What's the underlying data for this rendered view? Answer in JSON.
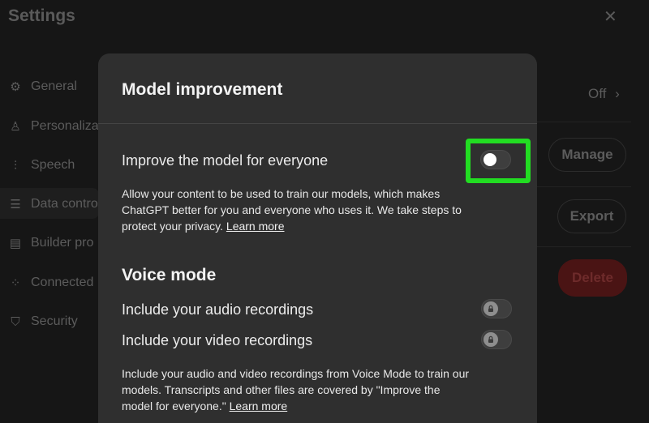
{
  "background": {
    "title": "Settings",
    "close_glyph": "✕",
    "nav": [
      {
        "icon": "gear-icon",
        "glyph": "⚙",
        "label": "General"
      },
      {
        "icon": "person-icon",
        "glyph": "♙",
        "label": "Personaliza"
      },
      {
        "icon": "waveform-icon",
        "glyph": "⫶",
        "label": "Speech"
      },
      {
        "icon": "database-icon",
        "glyph": "☰",
        "label": "Data contro"
      },
      {
        "icon": "builder-icon",
        "glyph": "▤",
        "label": "Builder pro"
      },
      {
        "icon": "apps-icon",
        "glyph": "⁘",
        "label": "Connected"
      },
      {
        "icon": "shield-icon",
        "glyph": "⛉",
        "label": "Security"
      }
    ],
    "right": {
      "off_label": "Off",
      "chevron": "›",
      "manage_label": "Manage",
      "export_label": "Export",
      "delete_label": "Delete"
    }
  },
  "modal": {
    "title": "Model improvement",
    "improve": {
      "label": "Improve the model for everyone",
      "desc": "Allow your content to be used to train our models, which makes ChatGPT better for you and everyone who uses it. We take steps to protect your privacy.",
      "link": "Learn more",
      "toggle_on": false
    },
    "voice": {
      "title": "Voice mode",
      "audio_label": "Include your audio recordings",
      "video_label": "Include your video recordings",
      "desc": "Include your audio and video recordings from Voice Mode to train our models. Transcripts and other files are covered by \"Improve the model for everyone.\"",
      "link": "Learn more"
    }
  },
  "colors": {
    "highlight": "#22dd22",
    "modal_bg": "#2f2f2f",
    "delete_bg": "#4a1414"
  }
}
